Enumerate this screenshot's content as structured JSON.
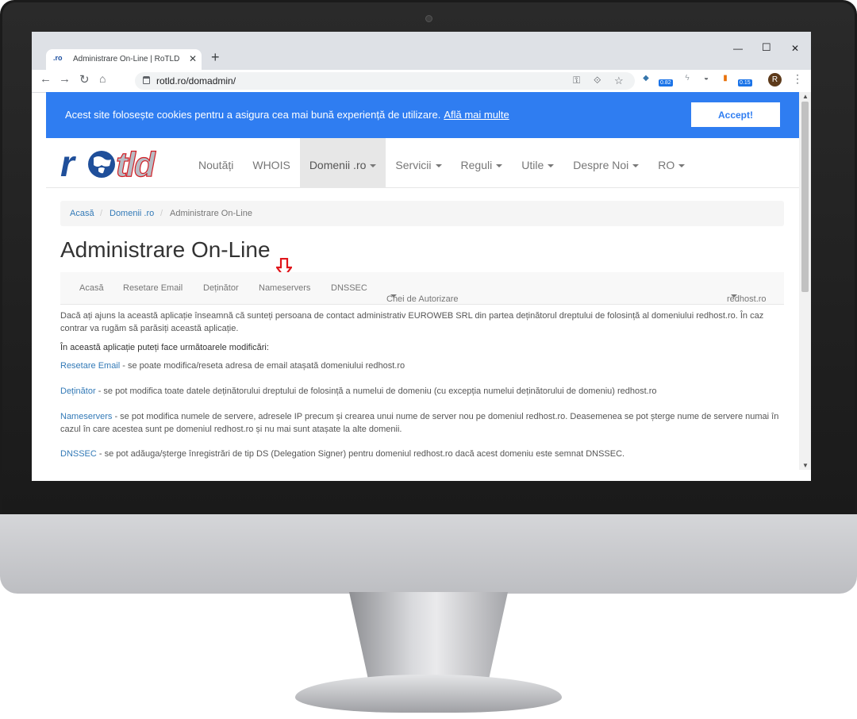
{
  "browser": {
    "favicon_text": ".ro",
    "tab_title": "Administrare On-Line | RoTLD - R",
    "url": "rotld.ro/domadmin/",
    "ext_badges": [
      "0.82",
      "0.15"
    ],
    "avatar_letter": "R"
  },
  "cookie": {
    "message": "Acest site folosește cookies pentru a asigura cea mai bună experiență de utilizare.",
    "link": "Află mai multe",
    "accept": "Accept!"
  },
  "navbar": {
    "items": [
      "Noutăți",
      "WHOIS",
      "Domenii .ro",
      "Servicii",
      "Reguli",
      "Utile",
      "Despre Noi",
      "RO"
    ]
  },
  "breadcrumb": [
    "Acasă",
    "Domenii .ro",
    "Administrare On-Line"
  ],
  "page_title": "Administrare On-Line",
  "subnav": {
    "items": [
      "Acasă",
      "Resetare Email",
      "Deținător",
      "Nameservers",
      "DNSSEC",
      "Chei de Autorizare"
    ],
    "domain": "redhost.ro"
  },
  "content": {
    "intro": "Dacă ați ajuns la această aplicație înseamnă că sunteți persoana de contact administrativ EUROWEB SRL din partea deținătorul dreptului de folosință al domeniului redhost.ro. În caz contrar va rugăm să parăsiți această aplicație.",
    "heading": "În această aplicație puteți face următoarele modificări:",
    "items": [
      {
        "link": "Resetare Email",
        "text": " - se poate modifica/reseta adresa de email atașată domeniului redhost.ro"
      },
      {
        "link": "Deținător",
        "text": " - se pot modifica toate datele deținătorului dreptului de folosință a numelui de domeniu (cu excepția numelui deținătorului de domeniu) redhost.ro"
      },
      {
        "link": "Nameservers",
        "text": " - se pot modifica numele de servere, adresele IP precum și crearea unui nume de server nou pe domeniul redhost.ro. Deasemenea se pot șterge nume de servere numai în cazul în care acestea sunt pe domeniul redhost.ro și nu mai sunt atașate la alte domenii."
      },
      {
        "link": "DNSSEC",
        "text": " - se pot adăuga/șterge înregistrări de tip DS (Delegation Signer) pentru domeniul redhost.ro dacă acest domeniu este semnat DNSSEC."
      }
    ]
  }
}
